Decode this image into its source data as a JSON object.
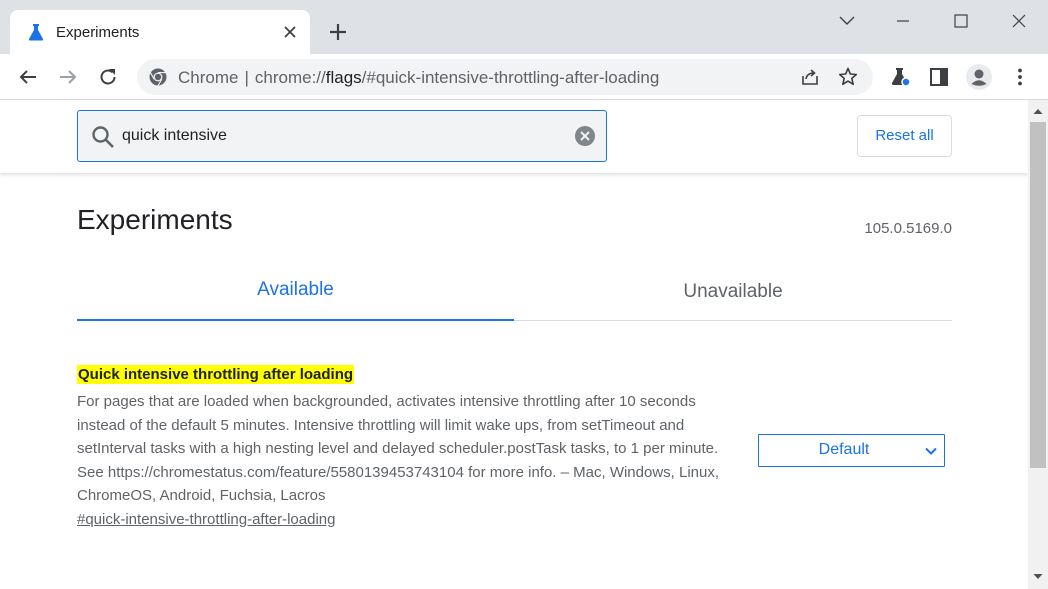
{
  "tab": {
    "title": "Experiments",
    "favicon": "flask-icon",
    "close_icon": "close-icon"
  },
  "window": {
    "chevron_icon": "chevron-down-icon",
    "minimize_icon": "minimize-icon",
    "maximize_icon": "maximize-icon",
    "close_icon": "close-icon"
  },
  "toolbar": {
    "back_icon": "arrow-left-icon",
    "forward_icon": "arrow-right-icon",
    "reload_icon": "reload-icon",
    "extensions_icon": "flask-icon",
    "sidepanel_icon": "side-panel-icon",
    "profile_icon": "avatar-icon",
    "menu_icon": "kebab-menu-icon"
  },
  "omnibox": {
    "site_label": "Chrome",
    "separator": "|",
    "url_scheme": "chrome://",
    "url_host": "flags",
    "url_path": "/#quick-intensive-throttling-after-loading",
    "share_icon": "share-icon",
    "star_icon": "star-icon"
  },
  "search": {
    "value": "quick intensive",
    "icon": "search-icon",
    "clear_icon": "clear-circle-icon"
  },
  "reset_button": "Reset all",
  "page_title": "Experiments",
  "version": "105.0.5169.0",
  "tabs": {
    "available": "Available",
    "unavailable": "Unavailable"
  },
  "flag": {
    "title": "Quick intensive throttling after loading",
    "description": "For pages that are loaded when backgrounded, activates intensive throttling after 10 seconds instead of the default 5 minutes. Intensive throttling will limit wake ups, from setTimeout and setInterval tasks with a high nesting level and delayed scheduler.postTask tasks, to 1 per minute. See https://chromestatus.com/feature/5580139453743104 for more info. – Mac, Windows, Linux, ChromeOS, Android, Fuchsia, Lacros",
    "link": "#quick-intensive-throttling-after-loading",
    "select_value": "Default"
  },
  "colors": {
    "accent": "#1a73e8",
    "highlight": "#ffff00",
    "tabstrip": "#dee1e6",
    "text_secondary": "#5f6368"
  }
}
